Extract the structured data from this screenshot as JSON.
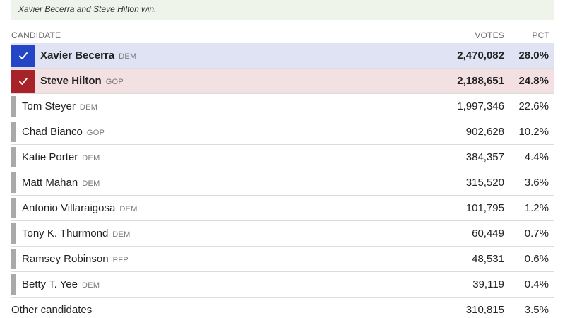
{
  "note": "Xavier Becerra and Steve Hilton win.",
  "headers": {
    "candidate": "CANDIDATE",
    "votes": "VOTES",
    "pct": "PCT"
  },
  "colors": {
    "dem_check": "#2546c4",
    "gop_check": "#a82329",
    "dem_row": "#dfe3f4",
    "gop_row": "#f3e0e2",
    "note_bg": "#eef4ea"
  },
  "winners": [
    {
      "name": "Xavier Becerra",
      "party": "DEM",
      "votes": "2,470,082",
      "pct": "28.0%",
      "icon": "checkmark-icon"
    },
    {
      "name": "Steve Hilton",
      "party": "GOP",
      "votes": "2,188,651",
      "pct": "24.8%",
      "icon": "checkmark-icon"
    }
  ],
  "candidates": [
    {
      "name": "Tom Steyer",
      "party": "DEM",
      "votes": "1,997,346",
      "pct": "22.6%"
    },
    {
      "name": "Chad Bianco",
      "party": "GOP",
      "votes": "902,628",
      "pct": "10.2%"
    },
    {
      "name": "Katie Porter",
      "party": "DEM",
      "votes": "384,357",
      "pct": "4.4%"
    },
    {
      "name": "Matt Mahan",
      "party": "DEM",
      "votes": "315,520",
      "pct": "3.6%"
    },
    {
      "name": "Antonio Villaraigosa",
      "party": "DEM",
      "votes": "101,795",
      "pct": "1.2%"
    },
    {
      "name": "Tony K. Thurmond",
      "party": "DEM",
      "votes": "60,449",
      "pct": "0.7%"
    },
    {
      "name": "Ramsey Robinson",
      "party": "PFP",
      "votes": "48,531",
      "pct": "0.6%"
    },
    {
      "name": "Betty T. Yee",
      "party": "DEM",
      "votes": "39,119",
      "pct": "0.4%"
    }
  ],
  "other": {
    "name": "Other candidates",
    "votes": "310,815",
    "pct": "3.5%"
  }
}
